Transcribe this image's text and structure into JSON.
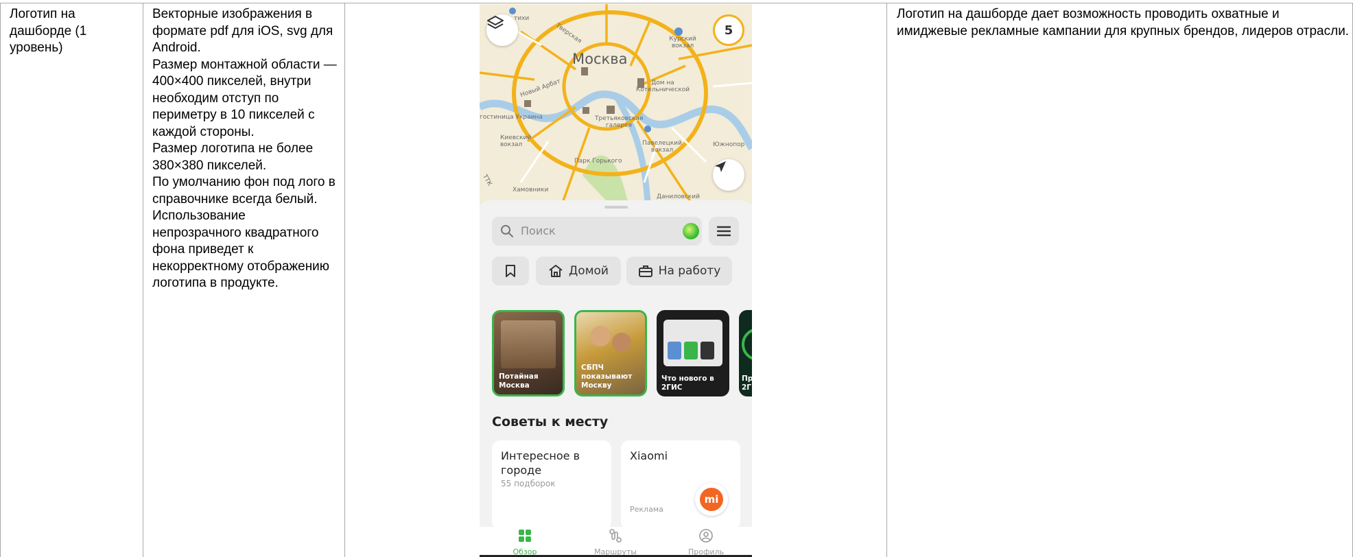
{
  "row": {
    "name": "Логотип на дашборде (1 уровень)",
    "requirements": [
      "Векторные изображения в формате pdf для iOS, svg для Android.",
      "Размер монтажной области — 400×400 пикселей, внутри необходим отступ по периметру в 10 пикселей с каждой стороны.",
      "Размер логотипа не более 380×380 пикселей.",
      "По умолчанию фон под лого в справочнике всегда белый.",
      "Использование непрозрачного квадратного фона приведет к некорректному отображению логотипа в продукте."
    ],
    "description": "Логотип на дашборде дает возможность проводить охватные и имиджевые рекламные кампании для крупных брендов, лидеров отрасли."
  },
  "phone": {
    "map": {
      "city": "Москва",
      "badge_count": "5",
      "labels": {
        "tverskaya": "Тверская",
        "kursky": "Курский вокзал",
        "novy_arbat": "Новый Арбат",
        "dom_kotelnich": "Дом на Котельнической",
        "gostinitsa": "гостиница Украина",
        "tretyakov": "Третьяковская галерея",
        "kievsky": "Киевский вокзал",
        "paveletsky": "Павелецкий вокзал",
        "yuzhnopor": "Южнопор",
        "park_gorkogo": "Парк Горького",
        "khamovniki": "Хамовники",
        "danilovsky": "Даниловский",
        "ttk": "ТТК",
        "tikhi": "тихи"
      },
      "icons": {
        "layers": "layers-icon",
        "locate": "navigation-arrow-icon"
      }
    },
    "search": {
      "placeholder": "Поиск"
    },
    "chips": {
      "home": "Домой",
      "work": "На работу"
    },
    "stories": [
      {
        "text": "Потайная Москва",
        "seen": true
      },
      {
        "text": "СБПЧ показывают Москву",
        "seen": true
      },
      {
        "text": "Что нового в 2ГИС",
        "seen": false
      },
      {
        "text": "Пр 2Г",
        "seen": false
      }
    ],
    "section_title": "Советы к месту",
    "cards": [
      {
        "title": "Интересное в городе",
        "subtitle": "55 подборок"
      },
      {
        "title": "Xiaomi",
        "ad": "Реклама",
        "logo": "mi"
      }
    ],
    "tabs": [
      {
        "label": "Обзор",
        "active": true
      },
      {
        "label": "Маршруты",
        "active": false
      },
      {
        "label": "Профиль",
        "active": false
      }
    ],
    "colors": {
      "accent": "#3ab54a",
      "map_bg": "#f3ecd8",
      "road": "#f3b21b",
      "river": "#a9cde8",
      "park": "#c9e2a8",
      "xiaomi": "#f26522"
    }
  }
}
